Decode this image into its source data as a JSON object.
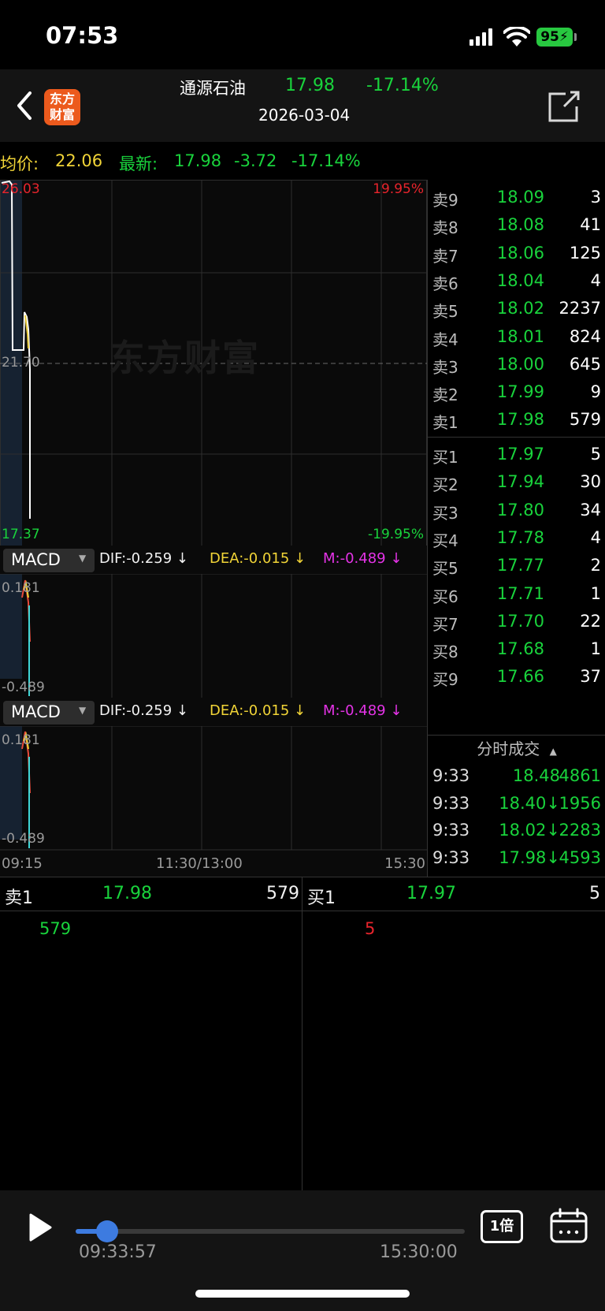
{
  "status_bar": {
    "time": "07:53",
    "battery": "95"
  },
  "header": {
    "logo_line1": "东方",
    "logo_line2": "财富",
    "stock_name": "通源石油",
    "price": "17.98",
    "change_pct": "-17.14%",
    "date": "2026-03-04"
  },
  "info_line": {
    "avg_label": "均价:",
    "avg_value": "22.06",
    "latest_label": "最新:",
    "latest_value": "17.98",
    "change": "-3.72",
    "change_pct": "-17.14%"
  },
  "price_chart": {
    "high_label": "26.03",
    "high_pct": "19.95%",
    "mid_label": "21.70",
    "low_label": "17.37",
    "low_pct": "-19.95%",
    "watermark": "东方财富"
  },
  "macd_panels": [
    {
      "selector": "MACD",
      "dif": "DIF:-0.259 ↓",
      "dea": "DEA:-0.015 ↓",
      "m": "M:-0.489 ↓",
      "top": "0.181",
      "bottom": "-0.489"
    },
    {
      "selector": "MACD",
      "dif": "DIF:-0.259 ↓",
      "dea": "DEA:-0.015 ↓",
      "m": "M:-0.489 ↓",
      "top": "0.181",
      "bottom": "-0.489"
    }
  ],
  "time_axis": {
    "start": "09:15",
    "mid": "11:30/13:00",
    "end": "15:30"
  },
  "order_book": {
    "asks": [
      {
        "label": "卖9",
        "price": "18.09",
        "volume": "3"
      },
      {
        "label": "卖8",
        "price": "18.08",
        "volume": "41"
      },
      {
        "label": "卖7",
        "price": "18.06",
        "volume": "125"
      },
      {
        "label": "卖6",
        "price": "18.04",
        "volume": "4"
      },
      {
        "label": "卖5",
        "price": "18.02",
        "volume": "2237"
      },
      {
        "label": "卖4",
        "price": "18.01",
        "volume": "824"
      },
      {
        "label": "卖3",
        "price": "18.00",
        "volume": "645"
      },
      {
        "label": "卖2",
        "price": "17.99",
        "volume": "9"
      },
      {
        "label": "卖1",
        "price": "17.98",
        "volume": "579"
      }
    ],
    "bids": [
      {
        "label": "买1",
        "price": "17.97",
        "volume": "5"
      },
      {
        "label": "买2",
        "price": "17.94",
        "volume": "30"
      },
      {
        "label": "买3",
        "price": "17.80",
        "volume": "34"
      },
      {
        "label": "买4",
        "price": "17.78",
        "volume": "4"
      },
      {
        "label": "买5",
        "price": "17.77",
        "volume": "2"
      },
      {
        "label": "买6",
        "price": "17.71",
        "volume": "1"
      },
      {
        "label": "买7",
        "price": "17.70",
        "volume": "22"
      },
      {
        "label": "买8",
        "price": "17.68",
        "volume": "1"
      },
      {
        "label": "买9",
        "price": "17.66",
        "volume": "37"
      }
    ]
  },
  "ticks": {
    "header": "分时成交",
    "rows": [
      {
        "time": "9:33",
        "price": "18.48",
        "volume": "4861"
      },
      {
        "time": "9:33",
        "price": "18.40↓",
        "volume": "1956"
      },
      {
        "time": "9:33",
        "price": "18.02↓",
        "volume": "2283"
      },
      {
        "time": "9:33",
        "price": "17.98↓",
        "volume": "4593"
      }
    ]
  },
  "summary": {
    "sell_label": "卖1",
    "sell_price": "17.98",
    "sell_volume": "579",
    "buy_label": "买1",
    "buy_price": "17.97",
    "buy_volume": "5",
    "sell_queue": "579",
    "buy_queue": "5"
  },
  "player": {
    "current_time": "09:33:57",
    "end_time": "15:30:00",
    "speed": "1倍",
    "progress": 0.08
  }
}
